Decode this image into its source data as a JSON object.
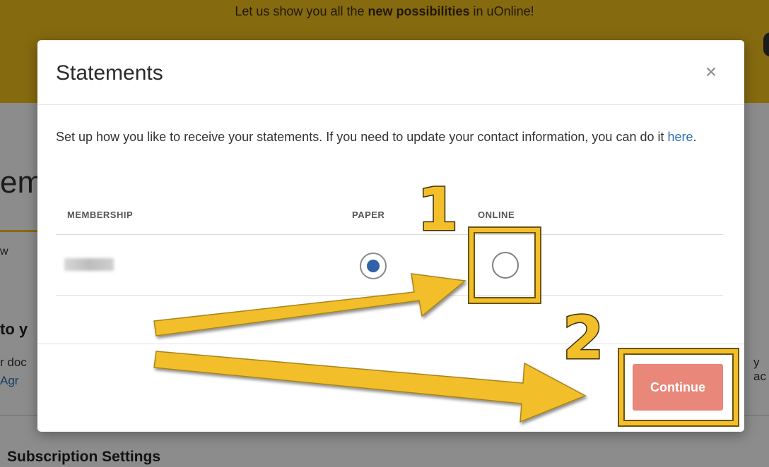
{
  "background": {
    "banner_text_prefix": "Let us show you all the ",
    "banner_text_bold": "new possibilities",
    "banner_text_suffix": " in uOnline!",
    "heading_fragment": "em",
    "tab_fragment": "w",
    "section_fragment": "to y",
    "doc_fragment": "r doc",
    "link_fragment": "Agr",
    "right_fragment": "y ac",
    "subscription_heading": "Subscription Settings"
  },
  "modal": {
    "title": "Statements",
    "close_label": "×",
    "description_prefix": "Set up how you like to receive your statements. If you need to update your contact information, you can do it ",
    "description_link": "here",
    "description_suffix": ".",
    "table": {
      "headers": {
        "membership": "MEMBERSHIP",
        "paper": "PAPER",
        "online": "ONLINE"
      },
      "rows": [
        {
          "membership": "",
          "paper_selected": true,
          "online_selected": false
        }
      ]
    },
    "continue_label": "Continue"
  },
  "annotations": {
    "step_1": "1",
    "step_2": "2",
    "color": "#f2bf2a"
  },
  "colors": {
    "banner": "#f4c21e",
    "radio_selected": "#2f63a8",
    "continue_button": "#e8877a",
    "link": "#2a6fb5"
  },
  "icons": {
    "close": "close-icon",
    "radio_selected": "radio-selected-icon",
    "radio_unselected": "radio-unselected-icon"
  }
}
